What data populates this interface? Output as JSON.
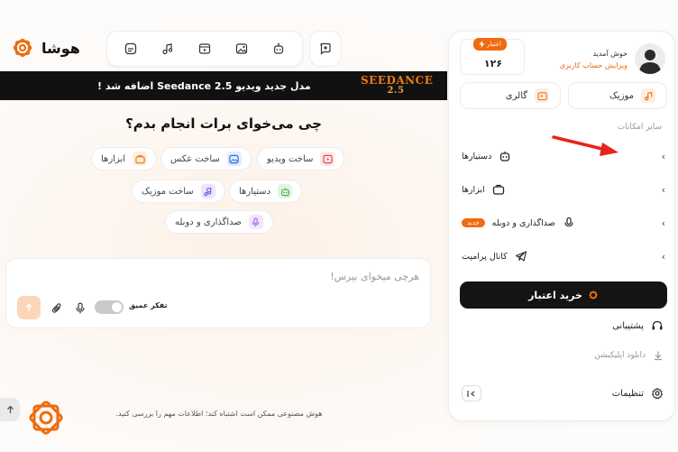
{
  "app": {
    "logo_text": "هوشا"
  },
  "toolbar": {
    "icons": [
      "chat-list-icon",
      "music-icon",
      "video-icon",
      "image-icon",
      "robot-icon"
    ],
    "new_chat_icon": "new-chat-icon"
  },
  "banner": {
    "text": "مدل جدید ویدیو Seedance 2.5 اضافه شد !",
    "logo_line1": "SEEDANCE",
    "logo_line2": "2.5"
  },
  "main": {
    "headline": "چی می‌خوای برات انجام بدم؟",
    "chips": [
      {
        "label": "ساخت ویدیو",
        "icon": "video-icon",
        "color": "#e8464d"
      },
      {
        "label": "ساخت عکس",
        "icon": "image-icon",
        "color": "#2a6fe0"
      },
      {
        "label": "ابزارها",
        "icon": "toolbox-icon",
        "color": "#ef7a18"
      },
      {
        "label": "دستیارها",
        "icon": "robot-icon",
        "color": "#3fb24a"
      },
      {
        "label": "ساخت موزیک",
        "icon": "music-icon",
        "color": "#7a56e0"
      },
      {
        "label": "صداگذاری و دوبله",
        "icon": "voice-icon",
        "color": "#a467e8"
      }
    ],
    "input_placeholder": "هرچی میخوای بپرس!",
    "deep_think_label": "تفکر عمیق",
    "footer_note": "هوش مصنوعی ممکن است اشتباه کند؛ اطلاعات مهم را بررسی کنید."
  },
  "panel": {
    "welcome": "خوش آمدید",
    "edit_account": "ویرایش حساب کاربری",
    "credit_label": "اعتبار",
    "credit_value": "۱۲۶",
    "quick": [
      {
        "label": "موزیک",
        "icon": "music-icon"
      },
      {
        "label": "گالری",
        "icon": "gallery-icon"
      }
    ],
    "section_title": "سایر امکانات",
    "menu": [
      {
        "label": "دستیارها",
        "icon": "robot-icon"
      },
      {
        "label": "ابزارها",
        "icon": "toolbox-icon"
      },
      {
        "label": "صداگذاری و دوبله",
        "icon": "voice-icon",
        "badge": "جدید"
      },
      {
        "label": "کانال پرامپت",
        "icon": "telegram-icon"
      }
    ],
    "buy_label": "خرید اعتبار",
    "support": "پشتیبانی",
    "download": "دانلود اپلیکیشن",
    "settings": "تنظیمات"
  },
  "colors": {
    "accent": "#ef6b0f",
    "dark": "#141414",
    "annotation_arrow": "#e8221c"
  }
}
